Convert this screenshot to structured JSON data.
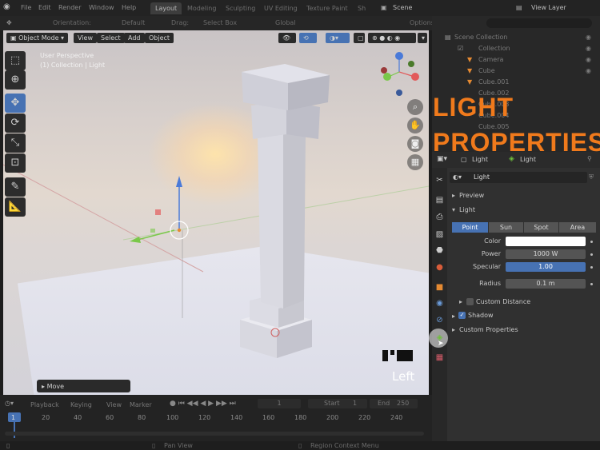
{
  "topbar": {
    "menus": [
      "File",
      "Edit",
      "Render",
      "Window",
      "Help"
    ],
    "tabs": [
      "Layout",
      "Modeling",
      "Sculpting",
      "UV Editing",
      "Texture Paint",
      "Sh"
    ],
    "scene": "Scene",
    "view_layer": "View Layer"
  },
  "toolbar2": {
    "orientation_label": "Orientation:",
    "orientation_value": "Default",
    "drag_label": "Drag:",
    "drag_value": "Select Box",
    "transform": "Global",
    "options": "Options"
  },
  "viewport": {
    "mode": "Object Mode",
    "menus": [
      "View",
      "Select",
      "Add",
      "Object"
    ],
    "perspective": "User Perspective",
    "collection": "(1) Collection | Light",
    "view_name": "Left",
    "move_panel": "Move"
  },
  "overlay": {
    "line1": "LIGHT",
    "line2": "PROPERTIES"
  },
  "outliner": {
    "root": "Scene Collection",
    "items": [
      "Collection",
      "Camera",
      "Cube",
      "Cube.001",
      "Cube.002",
      "Cube.003",
      "Cube.004",
      "Cube.005"
    ]
  },
  "props": {
    "header_object": "Light",
    "header_data": "Light",
    "datablock": "Light",
    "sections": {
      "preview": "Preview",
      "light": "Light",
      "custom_distance": "Custom Distance",
      "shadow": "Shadow",
      "custom_properties": "Custom Properties"
    },
    "light_types": [
      "Point",
      "Sun",
      "Spot",
      "Area"
    ],
    "fields": {
      "color_label": "Color",
      "power_label": "Power",
      "power_value": "1000 W",
      "specular_label": "Specular",
      "specular_value": "1.00",
      "radius_label": "Radius",
      "radius_value": "0.1 m"
    }
  },
  "timeline": {
    "menus": [
      "Playback",
      "Keying",
      "View",
      "Marker"
    ],
    "current_frame": "1",
    "start_label": "Start",
    "start_value": "1",
    "end_label": "End",
    "end_value": "250",
    "ticks": [
      "1",
      "20",
      "40",
      "60",
      "80",
      "100",
      "120",
      "140",
      "160",
      "180",
      "200",
      "220",
      "240"
    ]
  },
  "statusbar": {
    "pan": "Pan View",
    "context": "Region Context Menu"
  },
  "colors": {
    "accent": "#4772b3",
    "overlay_text": "#f07a1c",
    "object_orange": "#e58a32",
    "light_green": "#6fbf3c"
  }
}
